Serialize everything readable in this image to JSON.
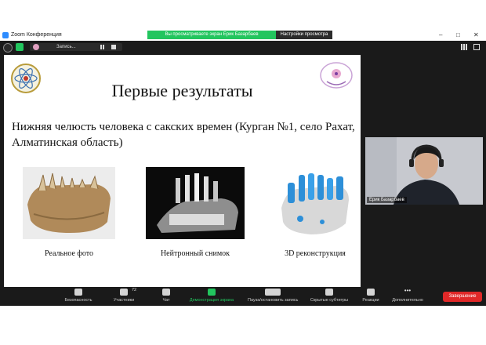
{
  "window": {
    "app_title": "Zoom Конференция",
    "share_banner": "Вы просматриваете экран Ерик Базарбаев",
    "view_settings": "Настройки просмотра",
    "controls": [
      "–",
      "□",
      "✕"
    ]
  },
  "recording": {
    "label": "Запись..."
  },
  "slide": {
    "title": "Первые результаты",
    "subtitle": "Нижняя челюсть человека с сакских времен (Курган №1, село Рахат, Алматинская область)",
    "images": [
      {
        "caption": "Реальное фото"
      },
      {
        "caption": "Нейтронный снимок"
      },
      {
        "caption": "3D реконструкция"
      }
    ]
  },
  "participant": {
    "name": "Ерик Базарбаев"
  },
  "toolbar": {
    "security": "Безопасность",
    "participants": "Участники",
    "participants_count": "72",
    "chat": "Чат",
    "share_screen": "Демонстрация экрана",
    "pause_recording": "Пауза/остановить запись",
    "subtitles": "Скрытые субтитры",
    "reactions": "Реакции",
    "more": "Дополнительно",
    "end": "Завершение"
  },
  "colors": {
    "banner_green": "#22c55e",
    "end_red": "#e02828",
    "zoom_blue": "#2d8cff"
  }
}
